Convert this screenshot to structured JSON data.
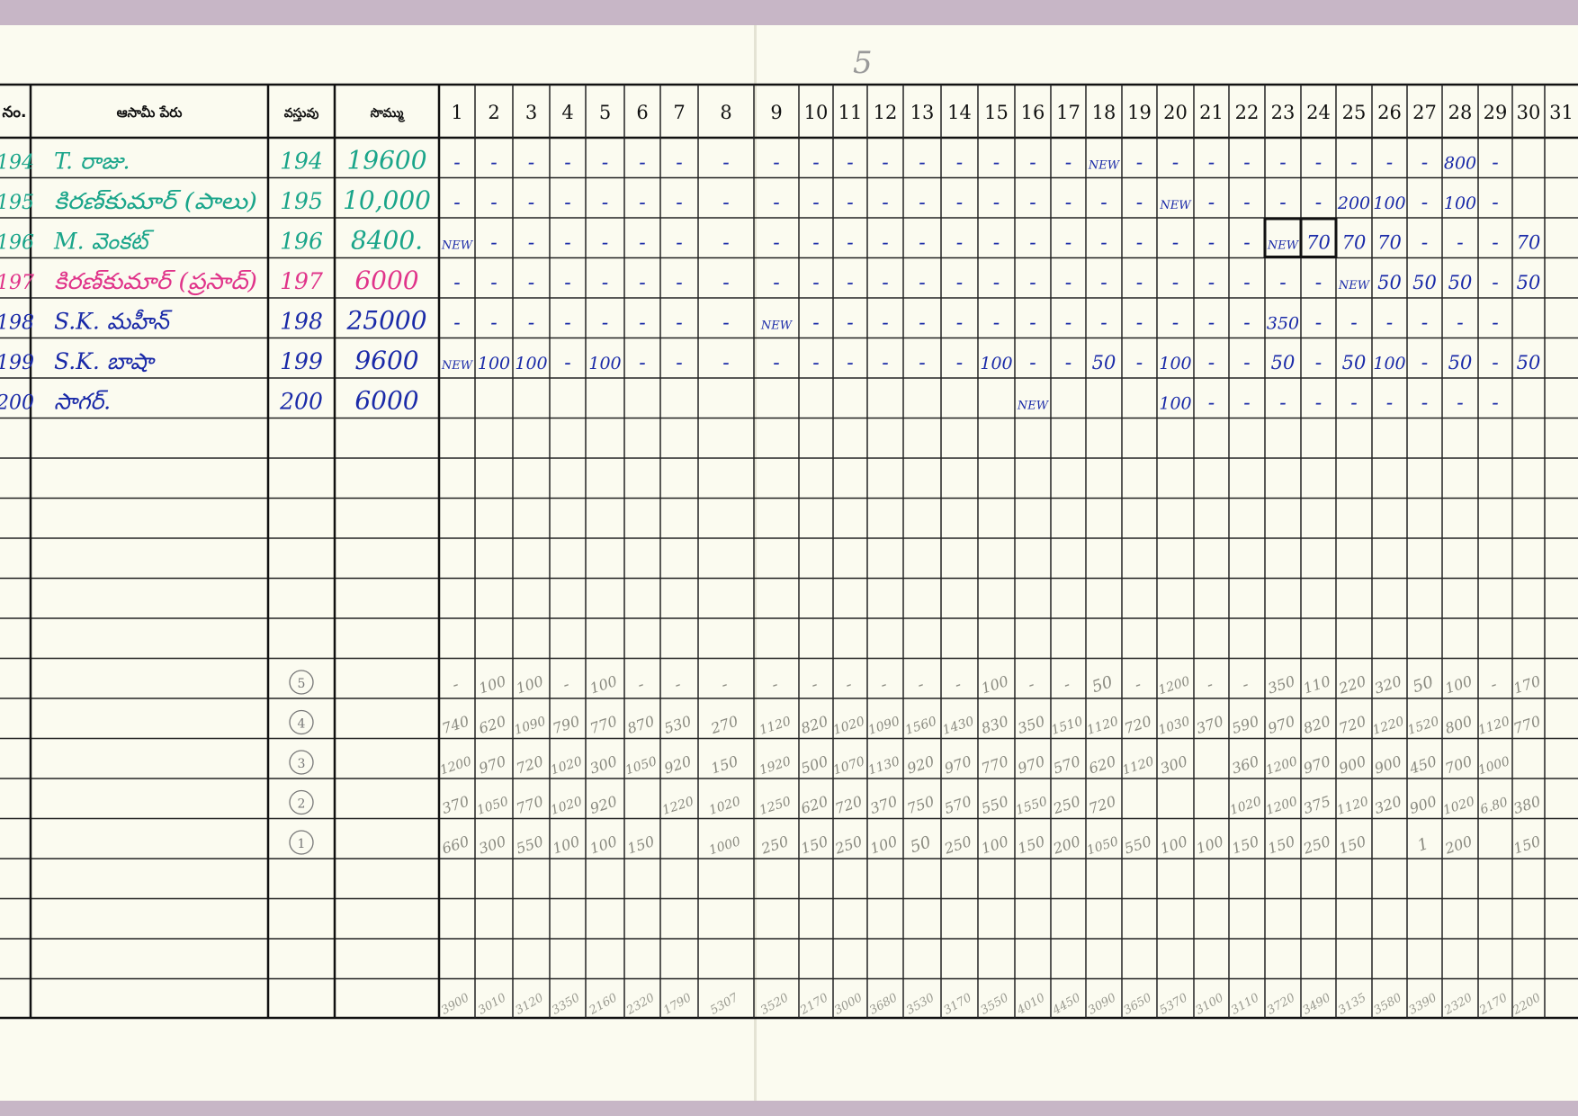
{
  "page_number": "5",
  "headers": {
    "sno": "నం.",
    "name": "ఆసామీ పేరు",
    "vastuvu": "వస్తువు",
    "sommu": "సొమ్ము",
    "days": [
      "1",
      "2",
      "3",
      "4",
      "5",
      "6",
      "7",
      "8",
      "9",
      "10",
      "11",
      "12",
      "13",
      "14",
      "15",
      "16",
      "17",
      "18",
      "19",
      "20",
      "21",
      "22",
      "23",
      "24",
      "25",
      "26",
      "27",
      "28",
      "29",
      "30",
      "31"
    ]
  },
  "entries": [
    {
      "sno": "194",
      "name": "T. రాజు.",
      "item": "194",
      "amount": "19600",
      "color": "#1aa58a",
      "days": [
        "-",
        "-",
        "-",
        "-",
        "-",
        "-",
        "-",
        "-",
        "-",
        "-",
        "-",
        "-",
        "-",
        "-",
        "-",
        "-",
        "-",
        "NEW",
        "-",
        "-",
        "-",
        "-",
        "-",
        "-",
        "-",
        "-",
        "-",
        "800",
        "-",
        "",
        ""
      ]
    },
    {
      "sno": "195",
      "name": "కిరణ్‌కుమార్ (పాలు)",
      "item": "195",
      "amount": "10,000",
      "color": "#1aa58a",
      "days": [
        "-",
        "-",
        "-",
        "-",
        "-",
        "-",
        "-",
        "-",
        "-",
        "-",
        "-",
        "-",
        "-",
        "-",
        "-",
        "-",
        "-",
        "-",
        "-",
        "NEW",
        "-",
        "-",
        "-",
        "-",
        "200",
        "100",
        "-",
        "100",
        "-",
        "",
        ""
      ]
    },
    {
      "sno": "196",
      "name": "M. వెంకట్",
      "item": "196",
      "amount": "8400.",
      "color": "#1aa58a",
      "days": [
        "NEW",
        "-",
        "-",
        "-",
        "-",
        "-",
        "-",
        "-",
        "-",
        "-",
        "-",
        "-",
        "-",
        "-",
        "-",
        "-",
        "-",
        "-",
        "-",
        "-",
        "-",
        "-",
        "NEW",
        "70",
        "70",
        "70",
        "-",
        "-",
        "-",
        "70",
        ""
      ]
    },
    {
      "sno": "197",
      "name": "కిరణ్‌కుమార్ (ప్రసాద్)",
      "item": "197",
      "amount": "6000",
      "color": "#e0348a",
      "days": [
        "-",
        "-",
        "-",
        "-",
        "-",
        "-",
        "-",
        "-",
        "-",
        "-",
        "-",
        "-",
        "-",
        "-",
        "-",
        "-",
        "-",
        "-",
        "-",
        "-",
        "-",
        "-",
        "-",
        "-",
        "NEW",
        "50",
        "50",
        "50",
        "-",
        "50",
        ""
      ]
    },
    {
      "sno": "198",
      "name": "S.K. మహీన్",
      "item": "198",
      "amount": "25000",
      "color": "#1a2aa8",
      "days": [
        "-",
        "-",
        "-",
        "-",
        "-",
        "-",
        "-",
        "-",
        "NEW",
        "-",
        "-",
        "-",
        "-",
        "-",
        "-",
        "-",
        "-",
        "-",
        "-",
        "-",
        "-",
        "-",
        "350",
        "-",
        "-",
        "-",
        "-",
        "-",
        "-",
        "",
        ""
      ]
    },
    {
      "sno": "199",
      "name": "S.K. బాషా",
      "item": "199",
      "amount": "9600",
      "color": "#1a2aa8",
      "days": [
        "NEW",
        "100",
        "100",
        "-",
        "100",
        "-",
        "-",
        "-",
        "-",
        "-",
        "-",
        "-",
        "-",
        "-",
        "100",
        "-",
        "-",
        "50",
        "-",
        "100",
        "-",
        "-",
        "50",
        "-",
        "50",
        "100",
        "-",
        "50",
        "-",
        "50",
        ""
      ]
    },
    {
      "sno": "200",
      "name": "సాగర్.",
      "item": "200",
      "amount": "6000",
      "color": "#1a2aa8",
      "days": [
        "",
        "",
        "",
        "",
        "",
        "",
        "",
        "",
        "",
        "",
        "",
        "",
        "",
        "",
        "",
        "NEW",
        "",
        "",
        "",
        "100",
        "-",
        "-",
        "-",
        "-",
        "-",
        "-",
        "-",
        "-",
        "-",
        "",
        ""
      ]
    }
  ],
  "summary_rows": [
    {
      "label": "5",
      "days": [
        "-",
        "100",
        "100",
        "-",
        "100",
        "-",
        "-",
        "-",
        "-",
        "-",
        "-",
        "-",
        "-",
        "-",
        "100",
        "-",
        "-",
        "50",
        "-",
        "1200",
        "-",
        "-",
        "350",
        "110",
        "220",
        "320",
        "50",
        "100",
        "-",
        "170",
        ""
      ]
    },
    {
      "label": "4",
      "days": [
        "740",
        "620",
        "1090",
        "790",
        "770",
        "870",
        "530",
        "270",
        "1120",
        "820",
        "1020",
        "1090",
        "1560",
        "1430",
        "830",
        "350",
        "1510",
        "1120",
        "720",
        "1030",
        "370",
        "590",
        "970",
        "820",
        "720",
        "1220",
        "1520",
        "800",
        "1120",
        "770",
        ""
      ]
    },
    {
      "label": "3",
      "days": [
        "1200",
        "970",
        "720",
        "1020",
        "300",
        "1050",
        "920",
        "150",
        "1920",
        "500",
        "1070",
        "1130",
        "920",
        "970",
        "770",
        "970",
        "570",
        "620",
        "1120",
        "300",
        "",
        "360",
        "1200",
        "970",
        "900",
        "900",
        "450",
        "700",
        "1000",
        "",
        ""
      ]
    },
    {
      "label": "2",
      "days": [
        "370",
        "1050",
        "770",
        "1020",
        "920",
        "",
        "1220",
        "1020",
        "1250",
        "620",
        "720",
        "370",
        "750",
        "570",
        "550",
        "1550",
        "250",
        "720",
        "",
        "",
        "",
        "1020",
        "1200",
        "375",
        "1120",
        "320",
        "900",
        "1020",
        "6.80",
        "380",
        ""
      ]
    },
    {
      "label": "1",
      "days": [
        "660",
        "300",
        "550",
        "100",
        "100",
        "150",
        "",
        "1000",
        "250",
        "150",
        "250",
        "100",
        "50",
        "250",
        "100",
        "150",
        "200",
        "1050",
        "550",
        "100",
        "100",
        "150",
        "150",
        "250",
        "150",
        "",
        "1",
        "200",
        "",
        "150",
        ""
      ]
    }
  ],
  "totals": [
    "3900",
    "3010",
    "3120",
    "3350",
    "2160",
    "2320",
    "1790",
    "5307",
    "3520",
    "2170",
    "3000",
    "3680",
    "3530",
    "3170",
    "3550",
    "4010",
    "4450",
    "3090",
    "3650",
    "5370",
    "3100",
    "3110",
    "3720",
    "3490",
    "3135",
    "3580",
    "3390",
    "2320",
    "2170",
    "2200",
    ""
  ]
}
